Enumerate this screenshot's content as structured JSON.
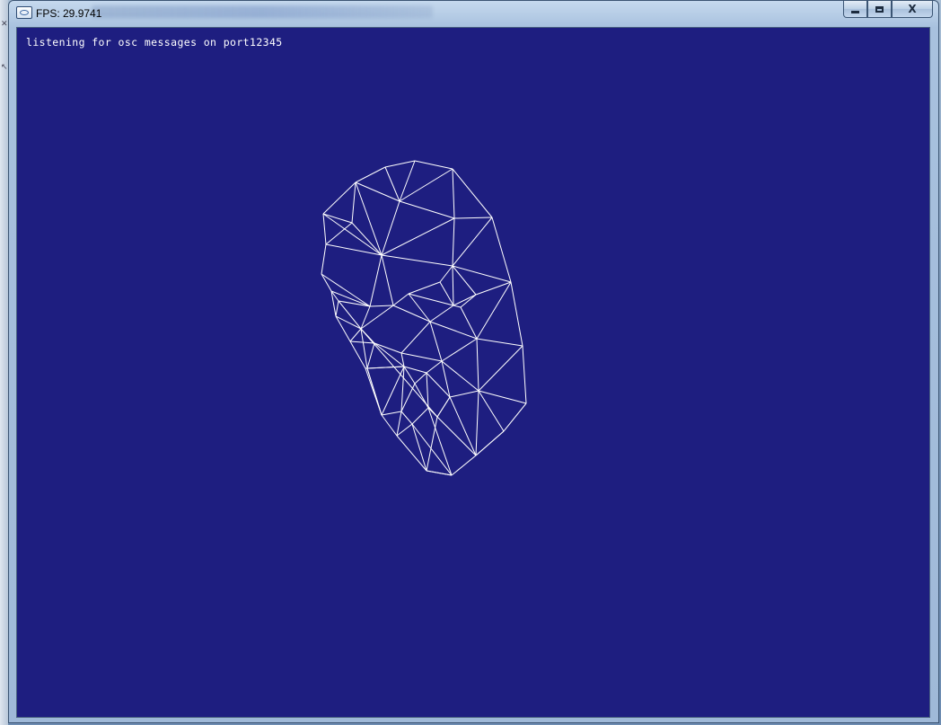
{
  "window": {
    "title": "FPS: 29.9741",
    "icon": "app-window-icon",
    "buttons": {
      "minimize": "minimize-icon",
      "maximize": "maximize-icon",
      "close_label": "X"
    }
  },
  "canvas": {
    "background_color": "#1e1e80",
    "status_text": "listening for osc messages on port12345",
    "mesh_color": "#ffffff"
  },
  "colors": {
    "titlebar": "#b9cfe8",
    "canvas": "#1e1e80"
  }
}
